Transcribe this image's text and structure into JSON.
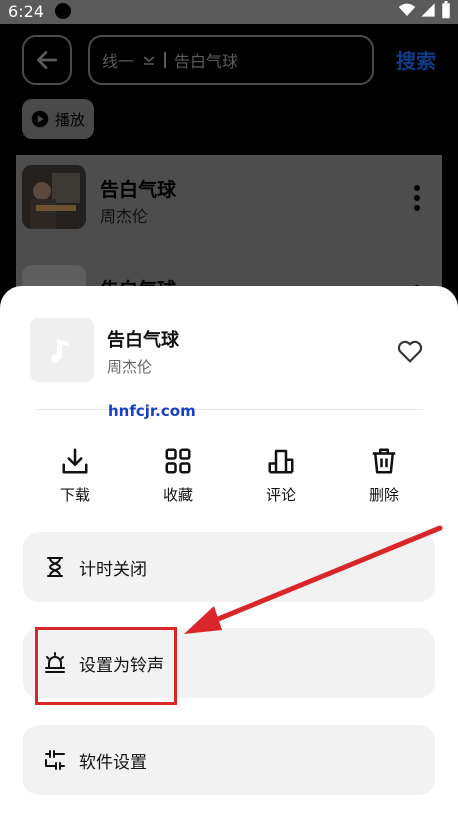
{
  "status_bar": {
    "time": "6:24",
    "icons": [
      "wifi-icon",
      "signal-icon",
      "battery-icon"
    ]
  },
  "search": {
    "line_selector": "线一",
    "query": "告白气球",
    "search_label": "搜索"
  },
  "play_button": {
    "label": "播放",
    "icon": "play-icon"
  },
  "results": [
    {
      "title": "告白气球",
      "artist": "周杰伦"
    },
    {
      "title": "告白气球",
      "artist": ""
    }
  ],
  "sheet": {
    "song_title": "告白气球",
    "artist": "周杰伦",
    "watermark": "hnfcjr.com",
    "actions": [
      {
        "label": "下载",
        "icon": "download-icon"
      },
      {
        "label": "收藏",
        "icon": "grid-collect-icon"
      },
      {
        "label": "评论",
        "icon": "comment-chart-icon"
      },
      {
        "label": "删除",
        "icon": "trash-icon"
      }
    ],
    "options": [
      {
        "label": "计时关闭",
        "icon": "hourglass-icon"
      },
      {
        "label": "设置为铃声",
        "icon": "alarm-bell-icon"
      },
      {
        "label": "软件设置",
        "icon": "settings-sliders-icon"
      }
    ]
  },
  "colors": {
    "accent_blue": "#0f3b88",
    "annotation_red": "#d8262a",
    "watermark_blue": "#1a3fc8"
  }
}
